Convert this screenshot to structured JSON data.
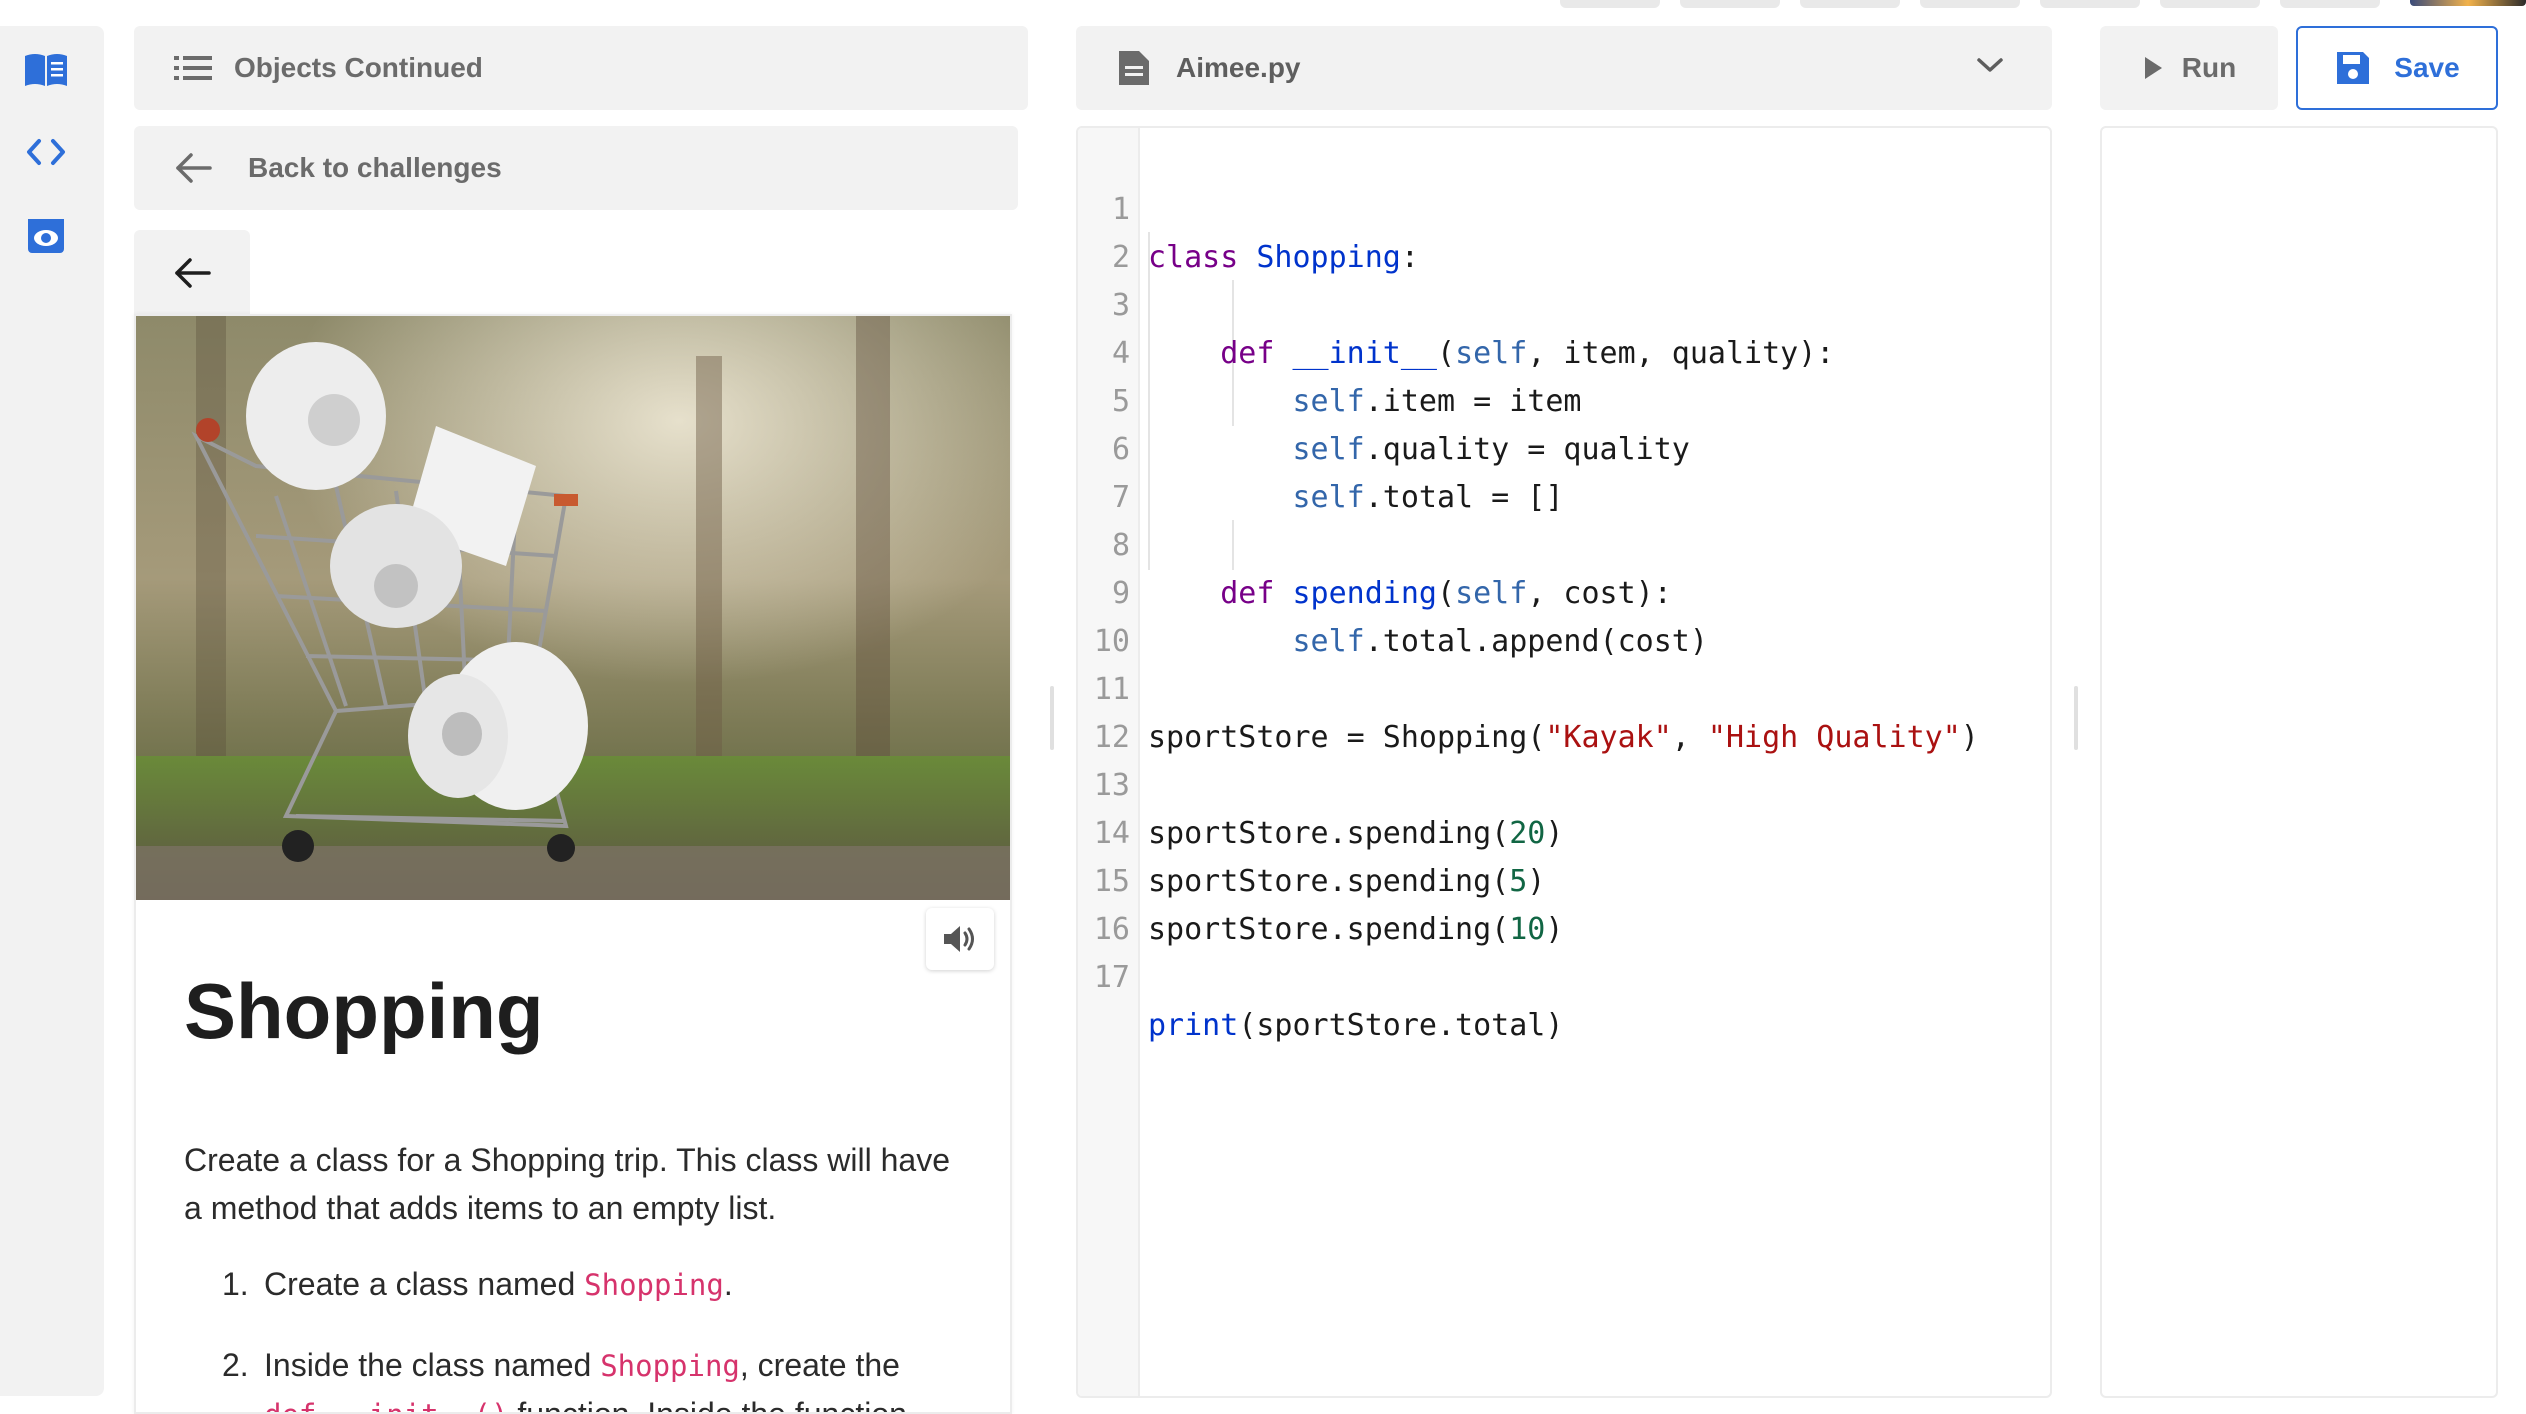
{
  "window": {
    "width": 2526,
    "height": 1414
  },
  "rail": {
    "items": [
      {
        "name": "instructions",
        "icon": "book-icon"
      },
      {
        "name": "code",
        "icon": "code-icon"
      },
      {
        "name": "preview",
        "icon": "eye-icon"
      }
    ]
  },
  "left_panel": {
    "section_title": "Objects Continued",
    "back_label": "Back to challenges",
    "card": {
      "title": "Shopping",
      "description": "Create a class for a Shopping trip. This class will have a method that adds items to an empty list.",
      "steps": [
        {
          "num": "1.",
          "pre": "Create a class named ",
          "code": "Shopping",
          "post": "."
        },
        {
          "num": "2.",
          "pre": "Inside the class named ",
          "code": "Shopping",
          "post": ", create the",
          "line2_code": "def __init__()",
          "line2_post": " function. Inside the function"
        }
      ]
    }
  },
  "editor": {
    "filename": "Aimee.py",
    "line_numbers": [
      "1",
      "2",
      "3",
      "4",
      "5",
      "6",
      "7",
      "8",
      "9",
      "10",
      "11",
      "12",
      "13",
      "14",
      "15",
      "16",
      "17"
    ]
  },
  "toolbar": {
    "run_label": "Run",
    "save_label": "Save",
    "accent_color": "#2e6fd9"
  }
}
